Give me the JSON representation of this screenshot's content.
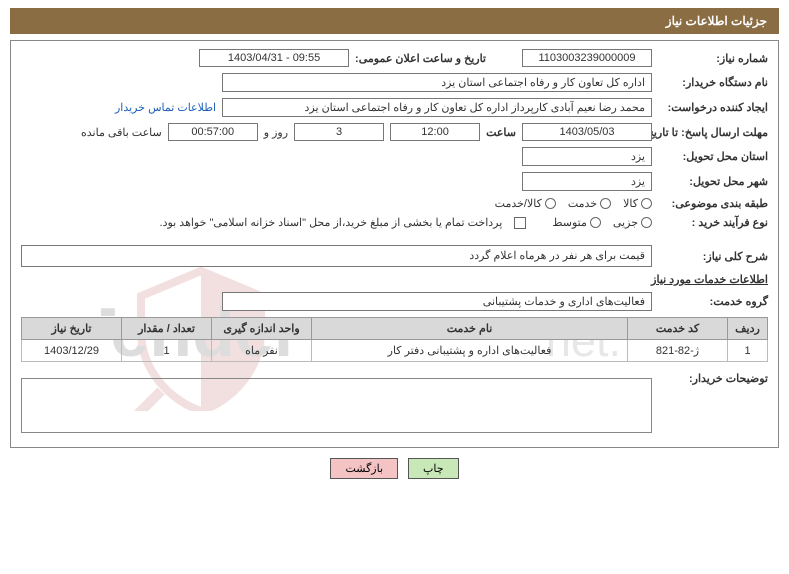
{
  "header": {
    "title": "جزئیات اطلاعات نیاز"
  },
  "fields": {
    "need_no_label": "شماره نیاز:",
    "need_no": "1103003239000009",
    "announce_label": "تاریخ و ساعت اعلان عمومی:",
    "announce": "1403/04/31 - 09:55",
    "buyer_org_label": "نام دستگاه خریدار:",
    "buyer_org": "اداره کل تعاون  کار و رفاه اجتماعی استان یزد",
    "requester_label": "ایجاد کننده درخواست:",
    "requester": "محمد رضا  نعیم آبادی کارپرداز اداره کل تعاون  کار و رفاه اجتماعی استان یزد",
    "contact_link": "اطلاعات تماس خریدار",
    "deadline_label": "مهلت ارسال پاسخ: تا تاریخ:",
    "deadline_date": "1403/05/03",
    "time_label": "ساعت",
    "deadline_time": "12:00",
    "days": "3",
    "days_label": "روز و",
    "remain_time": "00:57:00",
    "remain_label": "ساعت باقی مانده",
    "province_label": "استان محل تحویل:",
    "province": "یزد",
    "city_label": "شهر محل تحویل:",
    "city": "یزد",
    "class_label": "طبقه بندی موضوعی:",
    "class_opts": {
      "a": "کالا",
      "b": "خدمت",
      "c": "کالا/خدمت"
    },
    "process_label": "نوع فرآیند خرید :",
    "process_opts": {
      "a": "جزیی",
      "b": "متوسط"
    },
    "payment_note": "پرداخت تمام یا بخشی از مبلغ خرید،از محل \"اسناد خزانه اسلامی\" خواهد بود.",
    "general_label": "شرح کلی نیاز:",
    "general_desc": "قیمت برای هر نفر در هرماه اعلام گردد",
    "services_heading": "اطلاعات خدمات مورد نیاز",
    "group_label": "گروه خدمت:",
    "group_value": "فعالیت‌های اداری و خدمات پشتیبانی"
  },
  "table": {
    "headers": {
      "row": "ردیف",
      "code": "کد خدمت",
      "name": "نام خدمت",
      "unit": "واحد اندازه گیری",
      "qty": "تعداد / مقدار",
      "date": "تاریخ نیاز"
    },
    "rows": [
      {
        "row": "1",
        "code": "ژ-82-821",
        "name": "فعالیت‌های اداره و پشتیبانی دفتر کار",
        "unit": "نفر ماه",
        "qty": "1",
        "date": "1403/12/29"
      }
    ]
  },
  "buyer_notes_label": "توضیحات خریدار:",
  "buttons": {
    "print": "چاپ",
    "back": "بازگشت"
  }
}
